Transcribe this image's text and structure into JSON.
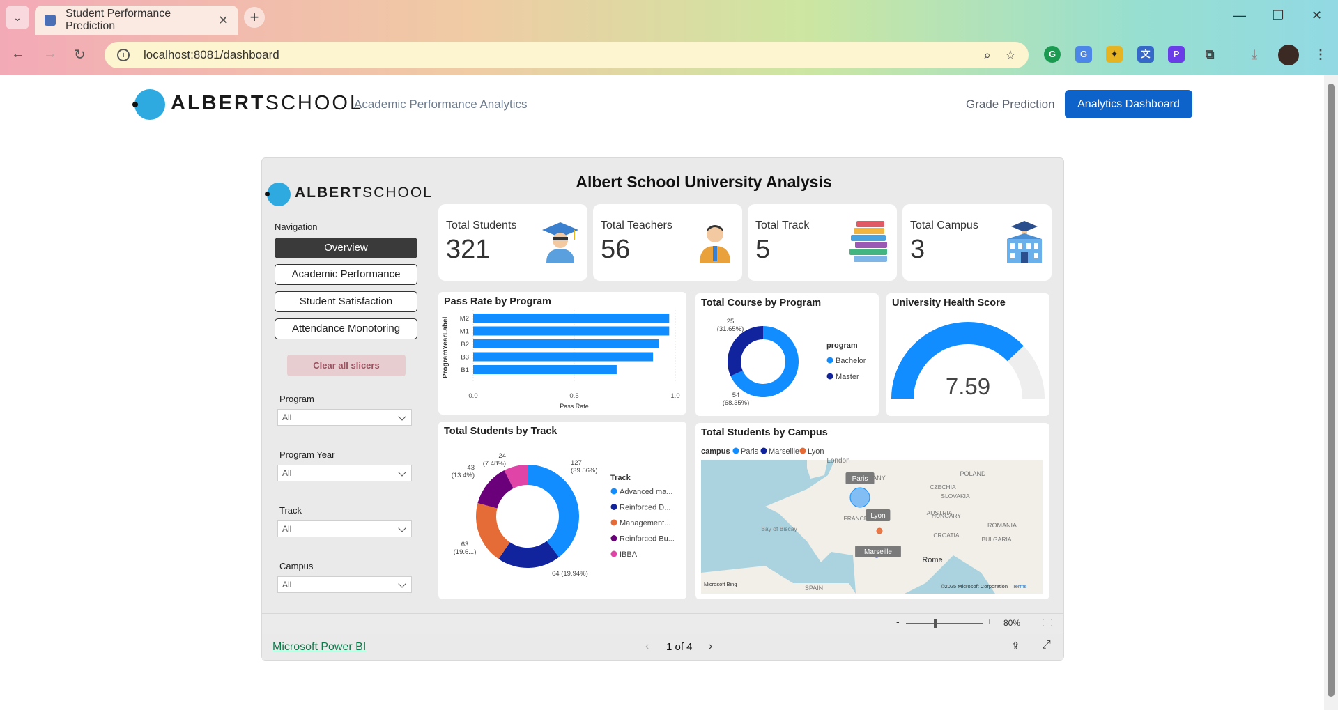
{
  "browser": {
    "tab_title": "Student Performance Prediction",
    "url": "localhost:8081/dashboard",
    "icons": [
      "back-icon",
      "forward-icon",
      "reload-icon",
      "zoom-icon",
      "star-icon",
      "extensions-icon",
      "download-icon",
      "menu-icon"
    ]
  },
  "app": {
    "logo_bold": "ALBERT",
    "logo_light": "SCHOOL",
    "subtitle": "Academic Performance Analytics",
    "nav_grade": "Grade Prediction",
    "nav_dashboard": "Analytics Dashboard",
    "brand_color": "#0d63c9"
  },
  "report": {
    "logo_bold": "ALBERT",
    "logo_light": "SCHOOL",
    "title": "Albert School University Analysis",
    "navigation_label": "Navigation",
    "nav_buttons": [
      "Overview",
      "Academic Performance",
      "Student Satisfaction",
      "Attendance Monotoring"
    ],
    "clear_label": "Clear all slicers",
    "slicers": [
      {
        "label": "Program",
        "value": "All"
      },
      {
        "label": "Program Year",
        "value": "All"
      },
      {
        "label": "Track",
        "value": "All"
      },
      {
        "label": "Campus",
        "value": "All"
      }
    ],
    "kpis": [
      {
        "label": "Total Students",
        "value": "321",
        "icon": "graduate-icon"
      },
      {
        "label": "Total Teachers",
        "value": "56",
        "icon": "teacher-icon"
      },
      {
        "label": "Total Track",
        "value": "5",
        "icon": "books-icon"
      },
      {
        "label": "Total Campus",
        "value": "3",
        "icon": "building-icon"
      }
    ],
    "footer_link": "Microsoft Power BI",
    "page": "1 of 4",
    "zoom": "80%"
  },
  "chart_data": [
    {
      "type": "bar",
      "title": "Pass Rate by Program",
      "ylabel": "ProgramYearLabel",
      "xlabel": "Pass Rate",
      "categories": [
        "M2",
        "M1",
        "B2",
        "B3",
        "B1"
      ],
      "values": [
        0.97,
        0.97,
        0.92,
        0.89,
        0.71
      ],
      "xlim": [
        0,
        1
      ],
      "ticks": [
        "0.0",
        "0.5",
        "1.0"
      ],
      "color": "#118DFF"
    },
    {
      "type": "pie",
      "title": "Total Course by Program",
      "legend_title": "program",
      "categories": [
        "Bachelor",
        "Master"
      ],
      "values": [
        54,
        25
      ],
      "labels": [
        "54\n(68.35%)",
        "25\n(31.65%)"
      ],
      "colors": [
        "#118DFF",
        "#12239E"
      ]
    },
    {
      "type": "gauge",
      "title": "University Health Score",
      "value": 7.59,
      "value_label": "7.59",
      "range": [
        0,
        10
      ],
      "colors": [
        "#118DFF",
        "#EEEEEE"
      ]
    },
    {
      "type": "pie",
      "title": "Total Students by Track",
      "legend_title": "Track",
      "categories": [
        "Advanced ma...",
        "Reinforced D...",
        "Management...",
        "Reinforced Bu...",
        "IBBA"
      ],
      "values": [
        127,
        64,
        63,
        43,
        24
      ],
      "labels": [
        "127\n(39.56%)",
        "64 (19.94%)",
        "63\n(19.6...)",
        "43\n(13.4%)",
        "24\n(7.48%)"
      ],
      "colors": [
        "#118DFF",
        "#12239E",
        "#E66C37",
        "#6B007B",
        "#E044A7"
      ]
    },
    {
      "type": "map",
      "title": "Total Students by Campus",
      "legend_title": "campus",
      "categories": [
        "Paris",
        "Marseille",
        "Lyon"
      ],
      "colors": [
        "#118DFF",
        "#12239E",
        "#E66C37"
      ],
      "map_labels": [
        "London",
        "GERMANY",
        "POLAND",
        "CZECHIA",
        "SLOVAKIA",
        "AUSTRIA",
        "HUNGARY",
        "ROMANIA",
        "CROATIA",
        "BULGARIA",
        "Bay of Biscay",
        "FRANCE",
        "SPAIN",
        "Rome",
        "Paris",
        "Lyon",
        "Marseille"
      ],
      "attribution": "©2025 Microsoft Corporation",
      "terms": "Terms",
      "bing": "Microsoft Bing"
    }
  ]
}
